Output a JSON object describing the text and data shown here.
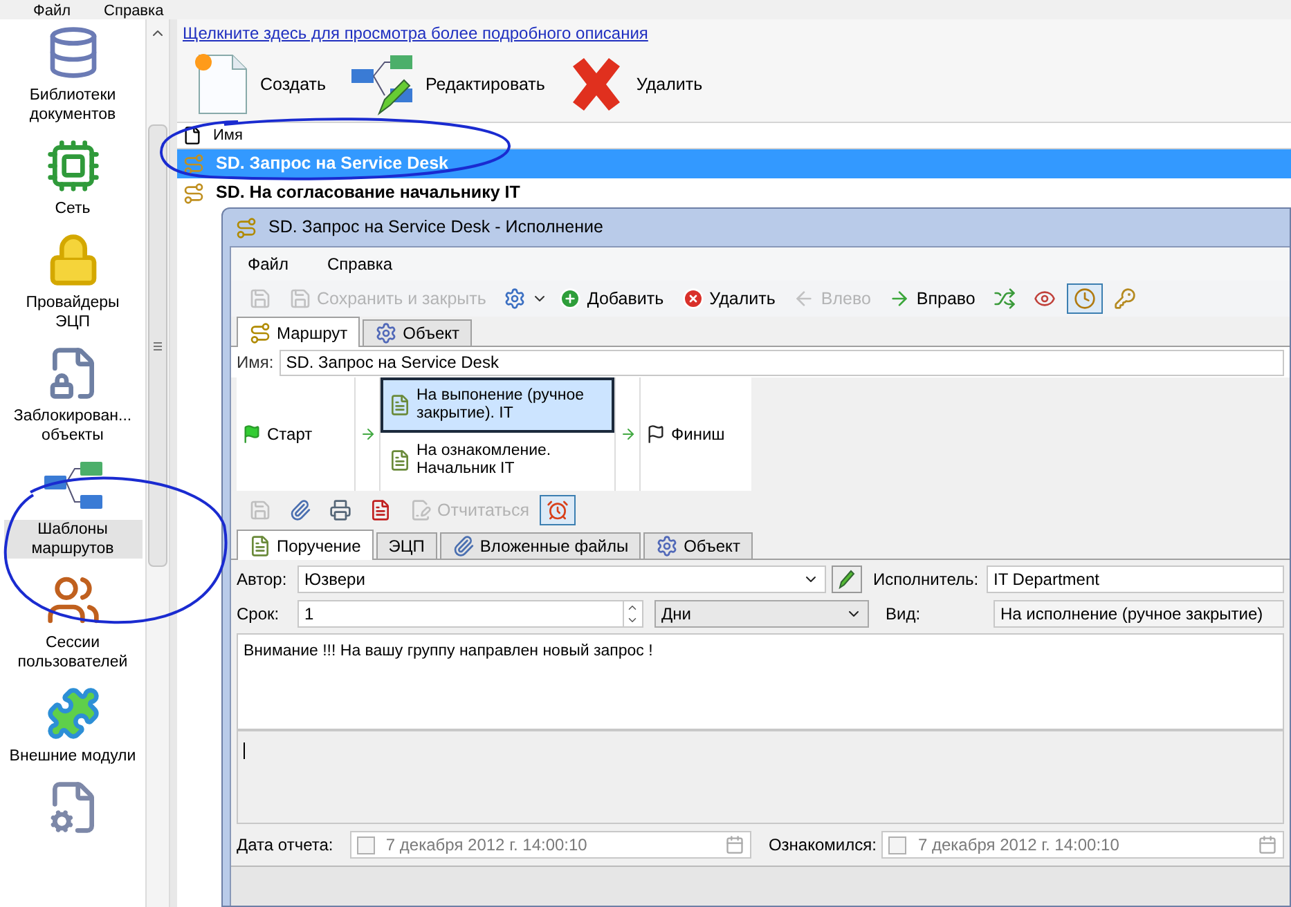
{
  "app_menu": [
    "Файл",
    "Справка"
  ],
  "sidebar": {
    "items": [
      {
        "label": "Библиотеки документов",
        "kind": "library",
        "selected": false
      },
      {
        "label": "Сеть",
        "kind": "network",
        "selected": false
      },
      {
        "label": "Провайдеры ЭЦП",
        "kind": "lock",
        "selected": false
      },
      {
        "label": "Заблокирован... объекты",
        "kind": "locked-file",
        "selected": false
      },
      {
        "label": "Шаблоны маршрутов",
        "kind": "route",
        "selected": true
      },
      {
        "label": "Сессии пользователей",
        "kind": "users",
        "selected": false
      },
      {
        "label": "Внешние модули",
        "kind": "puzzle",
        "selected": false
      },
      {
        "kind": "settings-file",
        "selected": false
      }
    ]
  },
  "info_link": "Щелкните здесь для просмотра более подробного описания",
  "toolbar": [
    {
      "label": "Создать",
      "kind": "new"
    },
    {
      "label": "Редактировать",
      "kind": "edit"
    },
    {
      "label": "Удалить",
      "kind": "delete"
    }
  ],
  "list": {
    "column": "Имя",
    "rows": [
      {
        "name": "SD. Запрос на Service Desk",
        "selected": true
      },
      {
        "name": "SD. На согласование начальнику IT",
        "selected": false
      }
    ]
  },
  "dialog": {
    "title": "SD. Запрос на Service Desk - Исполнение",
    "menu": [
      "Файл",
      "Справка"
    ],
    "toolbar": [
      {
        "kind": "save",
        "disabled": true,
        "active": false
      },
      {
        "kind": "save-close",
        "label": "Сохранить и закрыть",
        "disabled": true,
        "active": false
      },
      {
        "kind": "options",
        "disabled": false,
        "active": false
      },
      {
        "kind": "add",
        "label": "Добавить",
        "disabled": false,
        "active": false
      },
      {
        "kind": "remove",
        "label": "Удалить",
        "disabled": false,
        "active": false
      },
      {
        "kind": "left",
        "label": "Влево",
        "disabled": true,
        "active": false
      },
      {
        "kind": "right",
        "label": "Вправо",
        "disabled": false,
        "active": false
      },
      {
        "kind": "shuffle",
        "disabled": false,
        "active": false
      },
      {
        "kind": "view",
        "disabled": false,
        "active": false
      },
      {
        "kind": "clock",
        "disabled": false,
        "active": true
      },
      {
        "kind": "key",
        "disabled": false,
        "active": false
      }
    ],
    "tabs": [
      {
        "label": "Маршрут",
        "kind": "route",
        "selected": true
      },
      {
        "label": "Объект",
        "kind": "object",
        "selected": false
      }
    ],
    "name_label": "Имя:",
    "name_value": "SD. Запрос на Service Desk",
    "route": {
      "start": "Старт",
      "steps": [
        {
          "label": "На выпонение (ручное закрытие). IT",
          "selected": true
        },
        {
          "label": "На ознакомление. Начальник IT",
          "selected": false
        }
      ],
      "finish": "Финиш"
    },
    "task_toolbar": [
      {
        "kind": "save",
        "disabled": true,
        "active": false
      },
      {
        "kind": "attach",
        "disabled": false,
        "active": false
      },
      {
        "kind": "print",
        "disabled": false,
        "active": false
      },
      {
        "kind": "pdf",
        "disabled": false,
        "active": false
      },
      {
        "kind": "report",
        "label": "Отчитаться",
        "disabled": true,
        "active": false
      },
      {
        "kind": "alarm",
        "disabled": false,
        "active": true
      }
    ],
    "task_tabs": [
      {
        "label": "Поручение",
        "kind": "task",
        "selected": true
      },
      {
        "label": "ЭЦП",
        "kind": "lock",
        "selected": false
      },
      {
        "label": "Вложенные файлы",
        "kind": "attach",
        "selected": false
      },
      {
        "label": "Объект",
        "kind": "object",
        "selected": false
      }
    ],
    "form": {
      "author_label": "Автор:",
      "author": "Юзвери",
      "executor_label": "Исполнитель:",
      "executor": "IT Department",
      "term_label": "Срок:",
      "term": "1",
      "unit": "Дни",
      "type_label": "Вид:",
      "type": "На исполнение (ручное закрытие)"
    },
    "message": "Внимание !!! На вашу группу направлен новый запрос !",
    "report": {
      "label": "Дата отчета:",
      "date": "7 декабря  2012 г. 14:00:10",
      "checked": false
    },
    "ack": {
      "label": "Ознакомился:",
      "date": "7 декабря  2012 г. 14:00:10",
      "checked": false
    }
  }
}
